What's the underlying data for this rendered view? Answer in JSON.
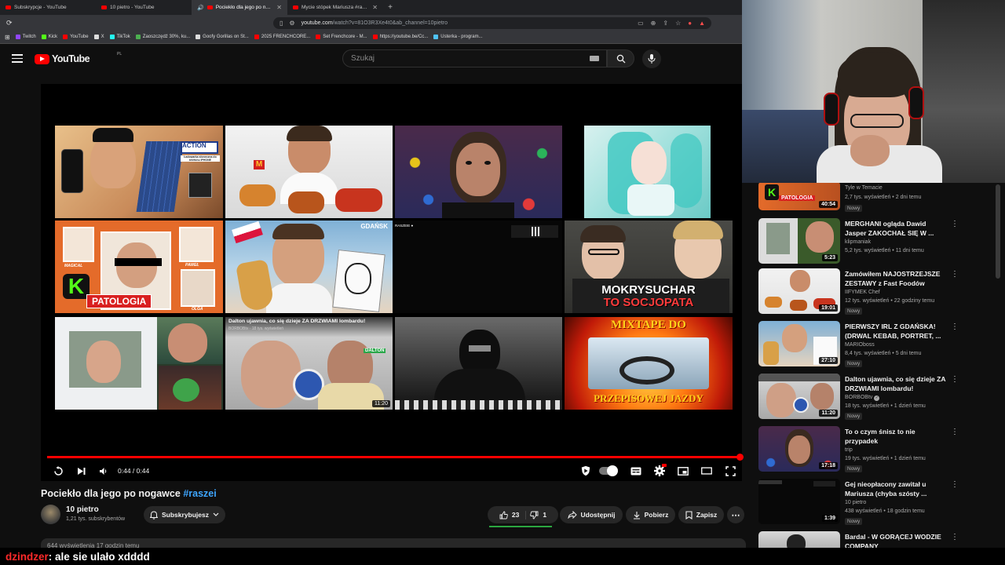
{
  "browser": {
    "tabs": [
      {
        "title": "Subskrypcje - YouTube",
        "active": false
      },
      {
        "title": "10 pietro - YouTube",
        "active": false
      },
      {
        "title": "Pociekło dla jego po nogawce",
        "active": true
      },
      {
        "title": "Mycie stópek Mariusza #raszei - You...",
        "active": false
      }
    ],
    "url_main": "youtube.com",
    "url_rest": "/watch?v=81O3R3Xe4t0&ab_channel=10pietro",
    "bookmarks": [
      {
        "label": "Twitch",
        "color": "#9146ff"
      },
      {
        "label": "Kick",
        "color": "#53fc18"
      },
      {
        "label": "YouTube",
        "color": "#ff0000"
      },
      {
        "label": "X",
        "color": "#ffffff"
      },
      {
        "label": "TikTok",
        "color": "#25f4ee"
      },
      {
        "label": "Zaoszczędź 30%, ku...",
        "color": "#4caf50"
      },
      {
        "label": "Goofy Gorillas on St...",
        "color": "#ffffff"
      },
      {
        "label": "2025 FRENCHCORE...",
        "color": "#ff0000"
      },
      {
        "label": "Set Frenchcore - M...",
        "color": "#ff0000"
      },
      {
        "label": "https://youtube.be/Cc...",
        "color": "#ff0000"
      },
      {
        "label": "Usterka - program...",
        "color": "#4fc3f7"
      }
    ]
  },
  "masthead": {
    "logo": "YouTube",
    "country": "PL",
    "search_placeholder": "Szukaj"
  },
  "player": {
    "time": "0:44 / 0:44",
    "progress": 1.0,
    "thumb_captions": {
      "action": "ACTION",
      "action_sub": "Ładowarka słoneczna do telefonu iPHONE",
      "gdansk": "GDAŃSK",
      "patologia": "PATOLOGIA",
      "magical": "MAGICAL",
      "pawel": "PAWEŁ",
      "olga": "OLGA",
      "mokry1": "MOKRYSUCHAR",
      "mokry2": "TO SOCJOPATA",
      "dalton": "Dalton ujawnia, co się dzieje ZA DRZWIAMI lombardu!",
      "dalton_ch": "BORBOBtv · 18 tys. wyświetleń",
      "dalton_dur": "11:20",
      "mixtape1": "MIXTAPE DO",
      "mixtape2": "PRZEPISOWEJ JAZDY",
      "dalton_badge": "DALTON"
    }
  },
  "video": {
    "title": "Pociekło dla jego po nogawce",
    "hashtag": "#raszei",
    "channel": "10 pietro",
    "subscribers": "1,21 tys. subskrybentów",
    "subscribe_label": "Subskrybujesz",
    "likes": "23",
    "dislikes": "1",
    "share": "Udostępnij",
    "download": "Pobierz",
    "save": "Zapisz",
    "desc_preview": "644 wyświetlenia  17 godzin temu"
  },
  "sidebar": {
    "items": [
      {
        "title": "",
        "channel": "Tyle w Temacie",
        "meta": "2,7 tys. wyświetleń • 2 dni temu",
        "badge": "Nowy",
        "duration": "40:54",
        "caption": "PATOLOGIA"
      },
      {
        "title": "MERGHANI ogląda Dawid Jasper ZAKOCHAŁ SIĘ W ...",
        "channel": "klipmaniak",
        "meta": "5,2 tys. wyświetleń • 11 dni temu",
        "badge": "",
        "duration": "5:23"
      },
      {
        "title": "Zamówiłem NAJOSTRZEJSZE ZESTAWY z Fast Foodów",
        "channel": "IIFYMEK Chef",
        "meta": "12 tys. wyświetleń • 22 godziny temu",
        "badge": "Nowy",
        "duration": "19:01"
      },
      {
        "title": "PIERWSZY IRL Z GDAŃSKA! (DRWAL KEBAB, PORTRET, ...",
        "channel": "MARIOboss",
        "meta": "8,4 tys. wyświetleń • 5 dni temu",
        "badge": "Nowy",
        "duration": "27:10"
      },
      {
        "title": "Dalton ujawnia, co się dzieje ZA DRZWIAMI lombardu!",
        "channel": "BORBOBtv",
        "meta": "18 tys. wyświetleń • 1 dzień temu",
        "badge": "Nowy",
        "duration": "11:20"
      },
      {
        "title": "To o czym śnisz to nie przypadek",
        "channel": "trip",
        "meta": "19 tys. wyświetleń • 1 dzień temu",
        "badge": "Nowy",
        "duration": "17:18"
      },
      {
        "title": "Gej nieopłacony zawitał u Mariusza (chyba szósty ...",
        "channel": "10 pietro",
        "meta": "438 wyświetleń • 18 godzin temu",
        "badge": "Nowy",
        "duration": "1:39"
      },
      {
        "title": "Bardal - W GORĄCEJ WODZIE COMPANY",
        "channel": "",
        "meta": "",
        "badge": "",
        "duration": ""
      }
    ]
  },
  "chat": {
    "user": "dzindzer",
    "message": ": ale sie ulało xdddd"
  },
  "colors": {
    "brand_red": "#ff0000",
    "link_blue": "#3ea6ff",
    "chat_user": "#ff2a2a"
  }
}
